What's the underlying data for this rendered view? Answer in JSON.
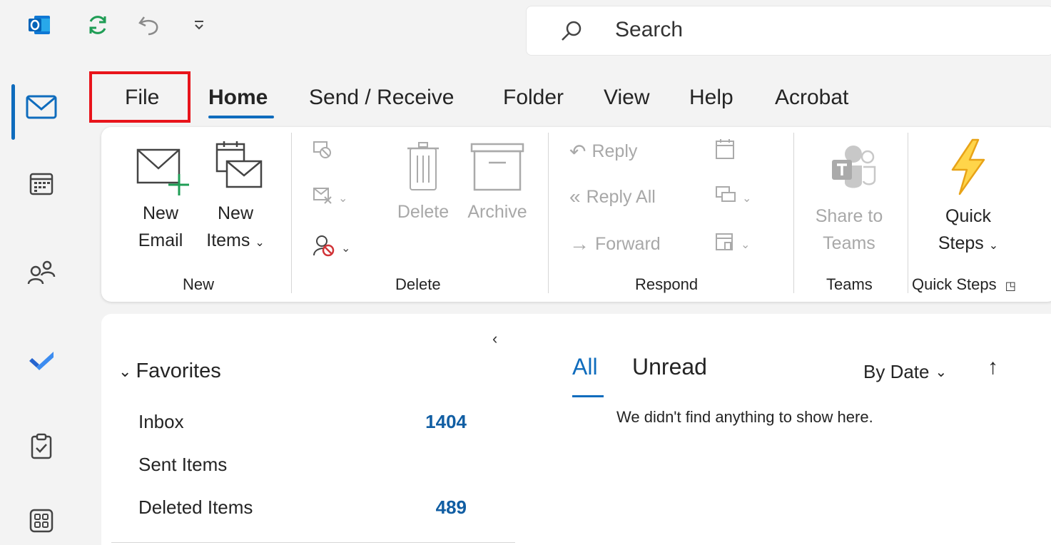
{
  "quick_access": {
    "sync_icon": "sync-icon",
    "undo_icon": "undo-icon",
    "customize_icon": "customize-icon"
  },
  "search": {
    "placeholder": "Search"
  },
  "tabs": [
    {
      "label": "File"
    },
    {
      "label": "Home"
    },
    {
      "label": "Send / Receive"
    },
    {
      "label": "Folder"
    },
    {
      "label": "View"
    },
    {
      "label": "Help"
    },
    {
      "label": "Acrobat"
    }
  ],
  "ribbon": {
    "new": {
      "new_email_line1": "New",
      "new_email_line2": "Email",
      "new_items_line1": "New",
      "new_items_line2": "Items",
      "group_label": "New"
    },
    "delete": {
      "delete_label": "Delete",
      "archive_label": "Archive",
      "group_label": "Delete"
    },
    "respond": {
      "reply_label": "Reply",
      "reply_all_label": "Reply All",
      "forward_label": "Forward",
      "group_label": "Respond"
    },
    "teams": {
      "share_line1": "Share to",
      "share_line2": "Teams",
      "group_label": "Teams"
    },
    "quick_steps": {
      "line1": "Quick",
      "line2": "Steps",
      "group_label": "Quick Steps"
    }
  },
  "folder_pane": {
    "favorites_label": "Favorites",
    "items": [
      {
        "label": "Inbox",
        "count": "1404"
      },
      {
        "label": "Sent Items",
        "count": ""
      },
      {
        "label": "Deleted Items",
        "count": "489"
      }
    ]
  },
  "message_list": {
    "tab_all": "All",
    "tab_unread": "Unread",
    "sort_label": "By Date",
    "empty_text": "We didn't find anything to show here."
  },
  "colors": {
    "accent": "#0f6cbd",
    "highlight_box": "#e8141b",
    "count": "#115ea3"
  }
}
